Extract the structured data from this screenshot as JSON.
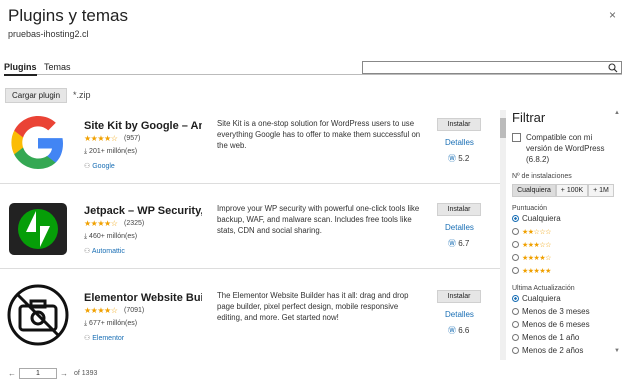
{
  "dialog": {
    "title": "Plugins y temas",
    "domain": "pruebas-ihosting2.cl",
    "close_glyph": "×"
  },
  "tabs": [
    {
      "label": "Plugins",
      "active": true
    },
    {
      "label": "Temas",
      "active": false
    }
  ],
  "search": {
    "value": "",
    "placeholder": ""
  },
  "toolbar": {
    "upload_label": "Cargar plugin",
    "zip_label": "*.zip"
  },
  "plugins": [
    {
      "name": "Site Kit by Google – Anal...",
      "rating_stars": "★★★★☆",
      "rating_count": "(957)",
      "installs": "201+ millón(es)",
      "author": "Google",
      "description": "Site Kit is a one-stop solution for WordPress users to use everything Google has to offer to make them successful on the web.",
      "install_label": "Instalar",
      "details_label": "Detalles",
      "version": "5.2",
      "logo_icon": "google-g-icon"
    },
    {
      "name": "Jetpack – WP Security, B...",
      "rating_stars": "★★★★☆",
      "rating_count": "(2325)",
      "installs": "460+ millón(es)",
      "author": "Automattic",
      "description": "Improve your WP security with powerful one-click tools like backup, WAF, and malware scan. Includes free tools like stats, CDN and social sharing.",
      "install_label": "Instalar",
      "details_label": "Detalles",
      "version": "6.7",
      "logo_icon": "jetpack-bolt-icon"
    },
    {
      "name": "Elementor Website Buil...",
      "rating_stars": "★★★★☆",
      "rating_count": "(7091)",
      "installs": "677+ millón(es)",
      "author": "Elementor",
      "description": "The Elementor Website Builder has it all: drag and drop page builder, pixel perfect design, mobile responsive editing, and more. Get started now!",
      "install_label": "Instalar",
      "details_label": "Detalles",
      "version": "6.6",
      "logo_icon": "camera-off-icon"
    }
  ],
  "filter": {
    "title": "Filtrar",
    "compat_label": "Compatible con mi versión de WordPress (6.8.2)",
    "installs_label": "Nº de instalaciones",
    "installs_options": [
      "Cualquiera",
      "+ 100K",
      "+ 1M"
    ],
    "rating_label": "Puntuación",
    "rating_any": "Cualquiera",
    "rating_options": [
      "★★☆☆☆",
      "★★★☆☆",
      "★★★★☆",
      "★★★★★"
    ],
    "update_label": "Ultima Actualización",
    "update_options": [
      "Cualquiera",
      "Menos de 3 meses",
      "Menos de 6 meses",
      "Menos de 1 año",
      "Menos de 2 años"
    ]
  },
  "pagination": {
    "current_page": "1",
    "total": "of 1393",
    "prev_glyph": "←",
    "next_glyph": "→"
  },
  "colors": {
    "accent": "#1a6fb5",
    "star": "#f0a000"
  }
}
